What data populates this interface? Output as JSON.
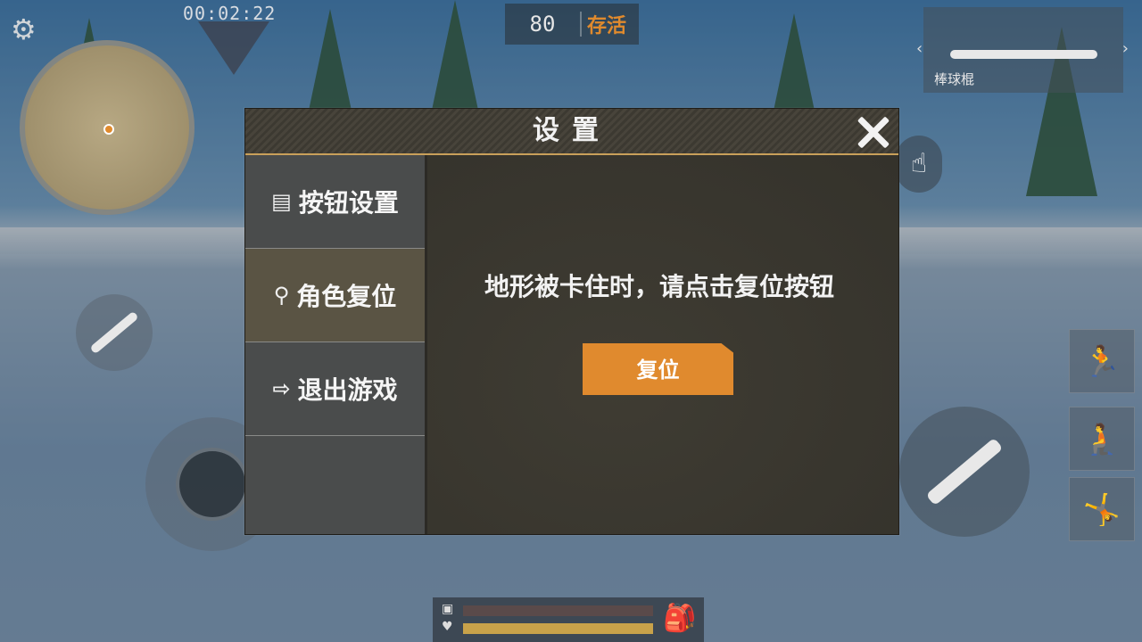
{
  "hud": {
    "timer": "00:02:22",
    "survivors_count": "80",
    "survivors_label": "存活",
    "weapon_name": "棒球棍"
  },
  "dialog": {
    "title": "设置",
    "menu": [
      {
        "label": "按钮设置",
        "icon": "button-settings-icon"
      },
      {
        "label": "角色复位",
        "icon": "character-reset-icon"
      },
      {
        "label": "退出游戏",
        "icon": "exit-icon"
      }
    ],
    "active_index": 1,
    "hint": "地形被卡住时，请点击复位按钮",
    "reset_label": "复位"
  },
  "colors": {
    "accent": "#e08a2e",
    "panel": "#3d3a32",
    "menu": "#4a4c4c"
  }
}
